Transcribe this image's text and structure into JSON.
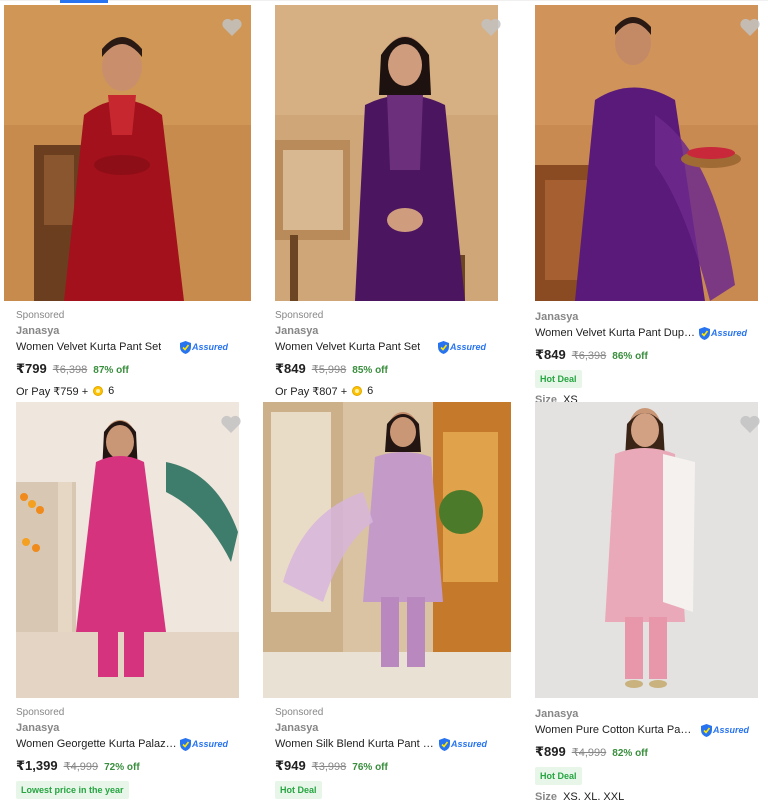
{
  "products": [
    {
      "sponsored": "Sponsored",
      "brand": "Janasya",
      "title": "Women Velvet Kurta Pant Set",
      "assured": "Assured",
      "price": "₹799",
      "mrp": "₹6,398",
      "discount": "87% off",
      "or_pay_prefix": "Or Pay ₹759 +",
      "or_pay_coins": "6",
      "badge": "",
      "size_label": "",
      "sizes": "",
      "image": {
        "bg": "#c78c4d",
        "dress": "#a3111c"
      }
    },
    {
      "sponsored": "Sponsored",
      "brand": "Janasya",
      "title": "Women Velvet Kurta Pant Set",
      "assured": "Assured",
      "price": "₹849",
      "mrp": "₹5,998",
      "discount": "85% off",
      "or_pay_prefix": "Or Pay ₹807 +",
      "or_pay_coins": "6",
      "badge": "",
      "size_label": "",
      "sizes": "",
      "image": {
        "bg": "#cfa677",
        "dress": "#4b1560"
      }
    },
    {
      "sponsored": "",
      "brand": "Janasya",
      "title": "Women Velvet Kurta Pant Dupatt...",
      "assured": "Assured",
      "price": "₹849",
      "mrp": "₹6,398",
      "discount": "86% off",
      "or_pay_prefix": "",
      "or_pay_coins": "",
      "badge": "Hot Deal",
      "size_label": "Size",
      "sizes": "XS",
      "image": {
        "bg": "#c98a52",
        "dress": "#5a1a7a"
      }
    },
    {
      "sponsored": "Sponsored",
      "brand": "Janasya",
      "title": "Women Georgette Kurta Palazzo...",
      "assured": "Assured",
      "price": "₹1,399",
      "mrp": "₹4,999",
      "discount": "72% off",
      "or_pay_prefix": "",
      "or_pay_coins": "",
      "badge": "Lowest price in the year",
      "size_label": "",
      "sizes": "",
      "image": {
        "bg": "#efe6de",
        "dress": "#d6337f"
      }
    },
    {
      "sponsored": "Sponsored",
      "brand": "Janasya",
      "title": "Women Silk Blend Kurta Pant Du...",
      "assured": "Assured",
      "price": "₹949",
      "mrp": "₹3,998",
      "discount": "76% off",
      "or_pay_prefix": "",
      "or_pay_coins": "",
      "badge": "Hot Deal",
      "size_label": "",
      "sizes": "",
      "image": {
        "bg": "#d9c3a3",
        "dress": "#c49ac9"
      }
    },
    {
      "sponsored": "",
      "brand": "Janasya",
      "title": "Women Pure Cotton Kurta Pant ...",
      "assured": "Assured",
      "price": "₹899",
      "mrp": "₹4,999",
      "discount": "82% off",
      "or_pay_prefix": "",
      "or_pay_coins": "",
      "badge": "Hot Deal",
      "size_label": "Size",
      "sizes": "XS, XL, XXL",
      "image": {
        "bg": "#e4e2e0",
        "dress": "#eaa9b8"
      }
    }
  ]
}
